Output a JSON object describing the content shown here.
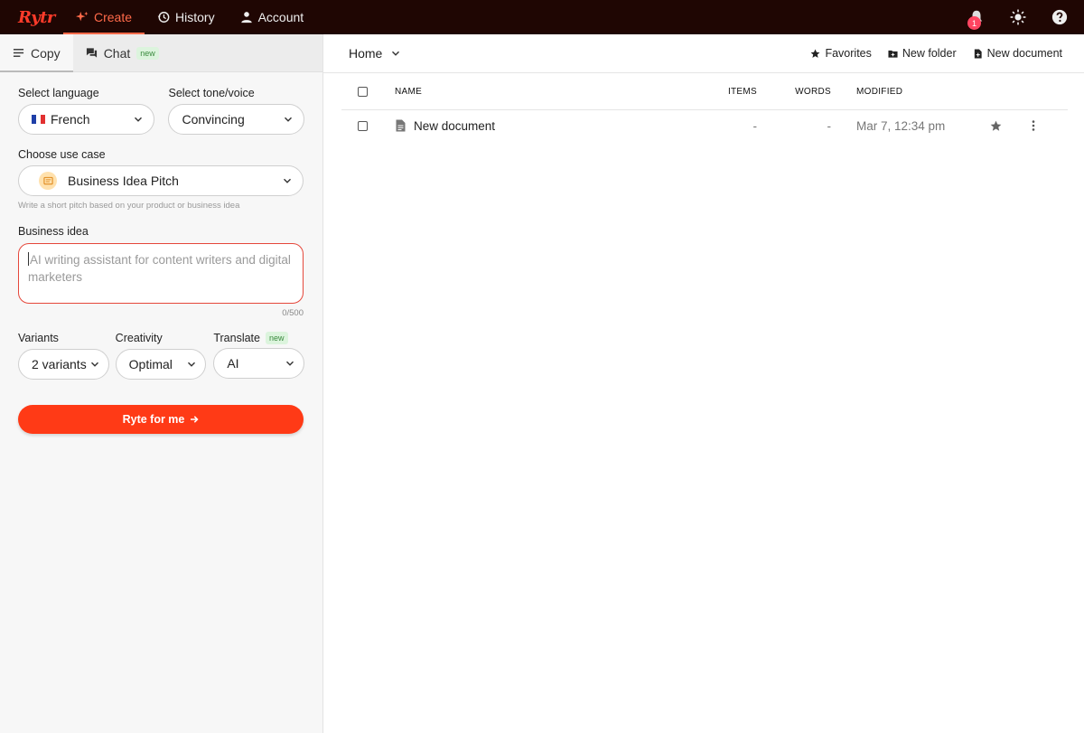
{
  "app": {
    "logo": "Rytr"
  },
  "nav": {
    "items": [
      {
        "label": "Create",
        "icon": "sparkle-icon",
        "active": true
      },
      {
        "label": "History",
        "icon": "history-icon",
        "active": false
      },
      {
        "label": "Account",
        "icon": "user-icon",
        "active": false
      }
    ]
  },
  "topbar": {
    "notification_count": "1"
  },
  "sidebar": {
    "tabs": [
      {
        "label": "Copy",
        "icon": "menu-lines-icon",
        "active": true
      },
      {
        "label": "Chat",
        "icon": "chat-icon",
        "badge": "new",
        "active": false
      }
    ],
    "language": {
      "label": "Select language",
      "value": "French"
    },
    "tone": {
      "label": "Select tone/voice",
      "value": "Convincing"
    },
    "use_case": {
      "label": "Choose use case",
      "value": "Business Idea Pitch",
      "hint": "Write a short pitch based on your product or business idea"
    },
    "business_idea": {
      "label": "Business idea",
      "placeholder": "AI writing assistant for content writers and digital marketers",
      "counter": "0/500"
    },
    "variants": {
      "label": "Variants",
      "value": "2 variants"
    },
    "creativity": {
      "label": "Creativity",
      "value": "Optimal"
    },
    "translate": {
      "label": "Translate",
      "badge": "new",
      "value": "AI"
    },
    "submit_label": "Ryte for me"
  },
  "main": {
    "breadcrumb": "Home",
    "actions": {
      "favorites": "Favorites",
      "new_folder": "New folder",
      "new_document": "New document"
    },
    "columns": {
      "name": "NAME",
      "items": "ITEMS",
      "words": "WORDS",
      "modified": "MODIFIED"
    },
    "rows": [
      {
        "name": "New document",
        "items": "-",
        "words": "-",
        "modified": "Mar 7, 12:34 pm"
      }
    ]
  },
  "colors": {
    "topbar": "#1f0603",
    "accent": "#ff3a16",
    "logo": "#ff3b2a"
  }
}
